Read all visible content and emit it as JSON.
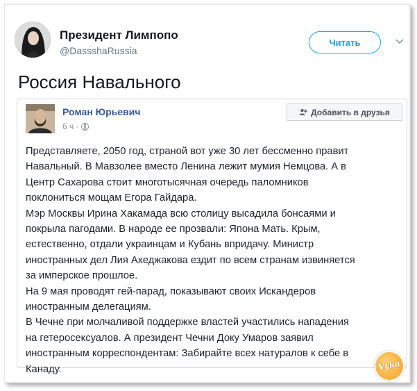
{
  "tweet": {
    "author_name": "Президент Лимпопо",
    "author_handle": "@DassshaRussia",
    "follow_label": "Читать",
    "text": "Россия Навального"
  },
  "fb_post": {
    "author_name": "Роман Юрьевич",
    "time": "6 ч ·",
    "add_friend_label": "Добавить в друзья",
    "lines": [
      "Представляете, 2050 год, страной вот уже 30 лет бессменно правит",
      "Навальный. В Мавзолее вместо Ленина лежит мумия Немцова. А в",
      "Центр Сахарова стоит многотысячная очередь паломников",
      "поклониться мощам Егора Гайдара.",
      "Мэр Москвы Ирина Хакамада всю столицу высадила бонсаями и",
      "покрыла пагодами. В народе ее прозвали: Япона Мать. Крым,",
      "естественно, отдали украинцам и Кубань впридачу. Министр",
      "иностранных дел Лия Ахеджакова ездит по всем странам извиняется",
      "за имперское прошлое.",
      "На 9 мая проводят гей-парад, показывают своих Искандеров",
      "иностранным делегациям.",
      "В Чечне при молчаливой поддержке властей участились нападения",
      "на гетеросексуалов. А президент Чечни Доку Умаров заявил",
      "иностранным корреспондентам: Забирайте всех натуралов к себе в",
      "Канаду."
    ]
  },
  "watermark": {
    "text": "Vyka"
  },
  "colors": {
    "follow_blue": "#1da1f2",
    "fb_link": "#365899",
    "text": "#14171a"
  },
  "icons": [
    "chevron-down-icon",
    "globe-icon",
    "add-friend-icon"
  ]
}
